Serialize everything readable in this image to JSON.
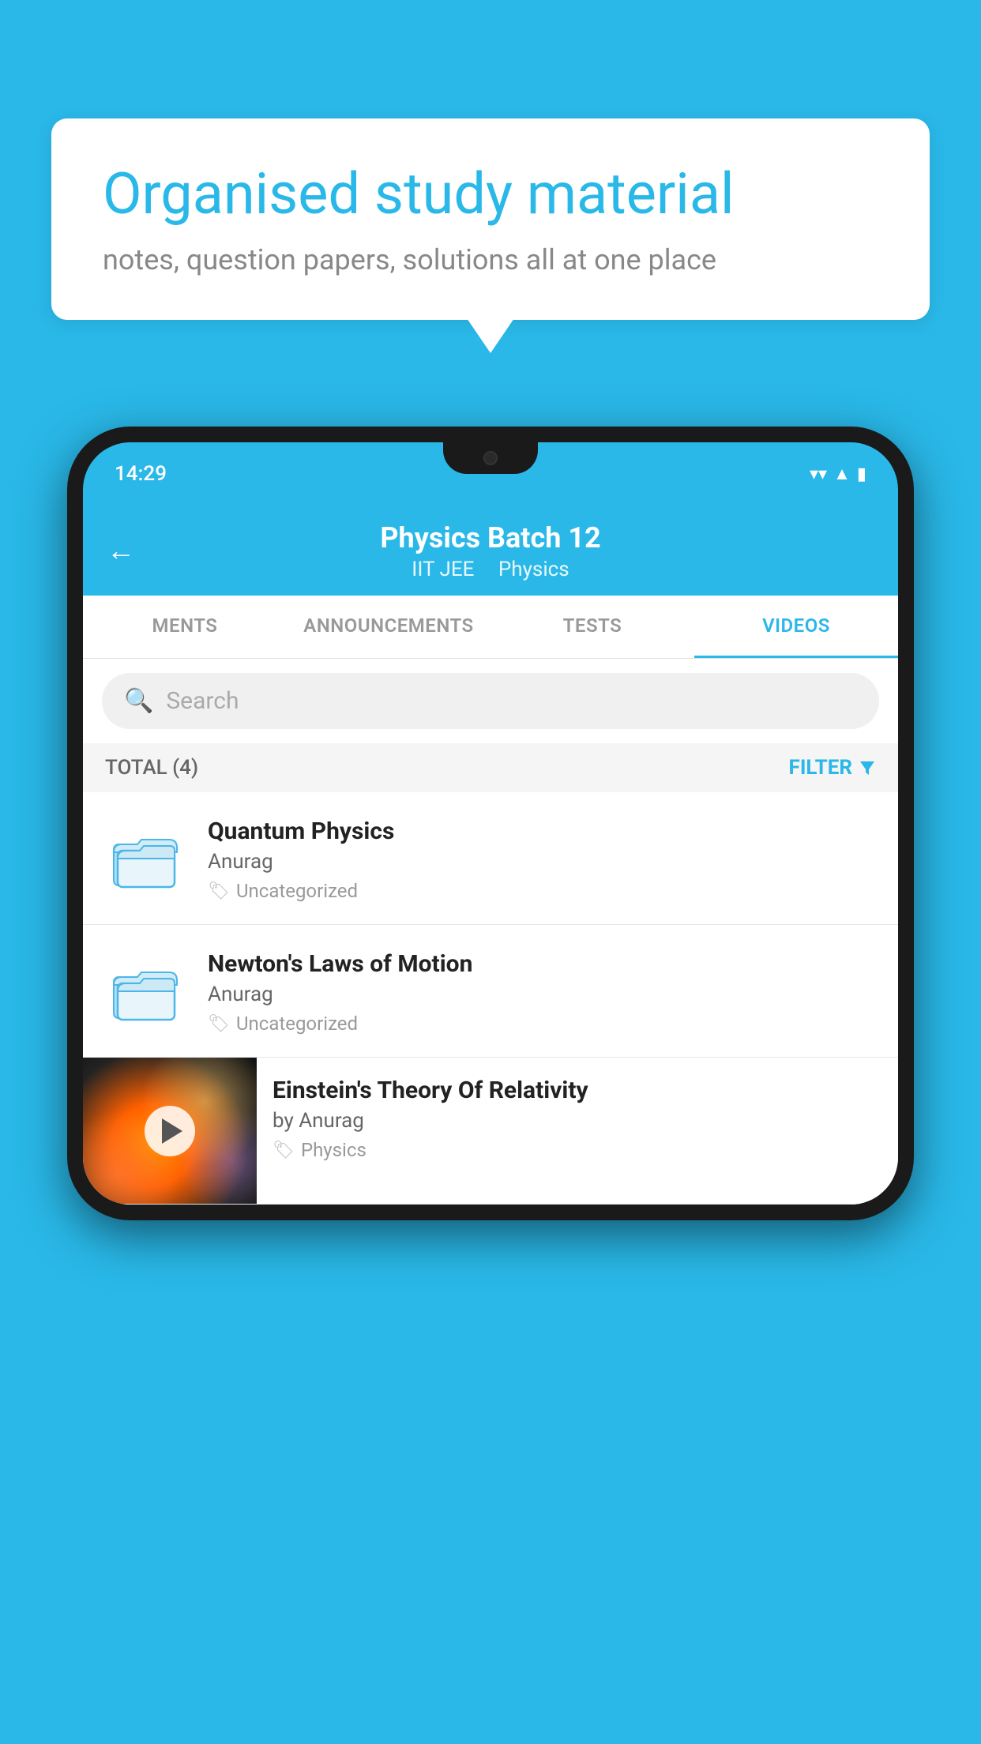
{
  "background_color": "#29b8e8",
  "speech_bubble": {
    "title": "Organised study material",
    "subtitle": "notes, question papers, solutions all at one place"
  },
  "phone": {
    "status_bar": {
      "time": "14:29",
      "icons": [
        "wifi",
        "signal",
        "battery"
      ]
    },
    "header": {
      "back_label": "←",
      "title": "Physics Batch 12",
      "subtitle_part1": "IIT JEE",
      "subtitle_part2": "Physics"
    },
    "tabs": [
      {
        "label": "MENTS",
        "active": false
      },
      {
        "label": "ANNOUNCEMENTS",
        "active": false
      },
      {
        "label": "TESTS",
        "active": false
      },
      {
        "label": "VIDEOS",
        "active": true
      }
    ],
    "search": {
      "placeholder": "Search"
    },
    "filter": {
      "total_label": "TOTAL (4)",
      "filter_label": "FILTER"
    },
    "videos": [
      {
        "id": 1,
        "title": "Quantum Physics",
        "author": "Anurag",
        "tag": "Uncategorized",
        "has_thumbnail": false
      },
      {
        "id": 2,
        "title": "Newton's Laws of Motion",
        "author": "Anurag",
        "tag": "Uncategorized",
        "has_thumbnail": false
      },
      {
        "id": 3,
        "title": "Einstein's Theory Of Relativity",
        "author": "by Anurag",
        "tag": "Physics",
        "has_thumbnail": true
      }
    ]
  }
}
